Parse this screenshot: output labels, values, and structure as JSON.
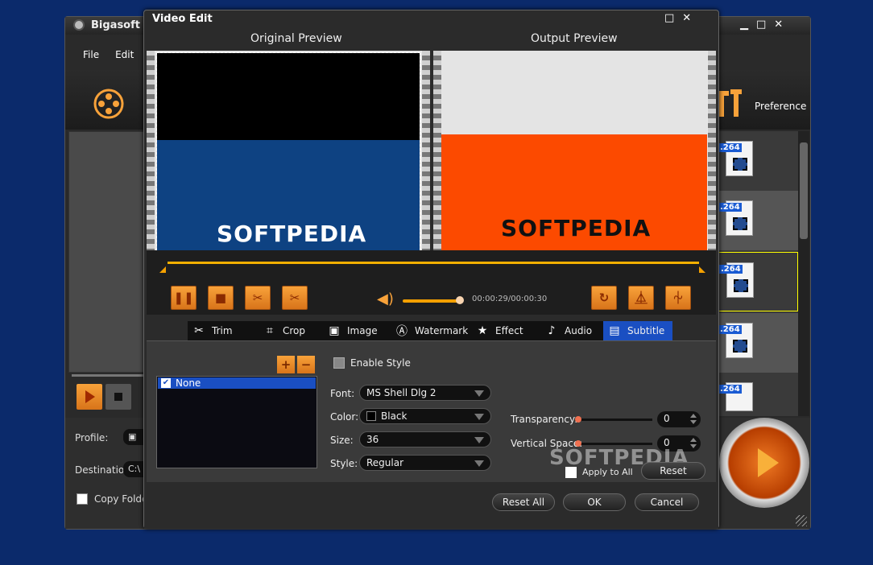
{
  "app": {
    "title": "Bigasoft To",
    "menu": [
      "File",
      "Edit"
    ],
    "preference_label": "Preference",
    "profile_label": "Profile:",
    "destination_label": "Destination:",
    "destination_value": "C:\\",
    "copy_folder_label": "Copy Folder",
    "file_tag": ".264"
  },
  "dialog": {
    "title": "Video Edit",
    "original_preview_label": "Original Preview",
    "output_preview_label": "Output Preview",
    "logo_text": "SOFTPEDIA",
    "time_display": "00:00:29/00:00:30",
    "tabs": [
      {
        "label": "Trim",
        "icon": "scissors-icon"
      },
      {
        "label": "Crop",
        "icon": "crop-icon"
      },
      {
        "label": "Image",
        "icon": "image-icon"
      },
      {
        "label": "Watermark",
        "icon": "watermark-icon"
      },
      {
        "label": "Effect",
        "icon": "star-icon"
      },
      {
        "label": "Audio",
        "icon": "music-note-icon"
      },
      {
        "label": "Subtitle",
        "icon": "subtitle-icon"
      }
    ],
    "active_tab": "Subtitle",
    "subtitle": {
      "list_items": [
        "None"
      ],
      "enable_style_label": "Enable Style",
      "font_label": "Font:",
      "font_value": "MS Shell Dlg 2",
      "color_label": "Color:",
      "color_value": "Black",
      "size_label": "Size:",
      "size_value": "36",
      "style_label": "Style:",
      "style_value": "Regular",
      "transparency_label": "Transparency:",
      "transparency_value": "0",
      "vertical_space_label": "Vertical Space:",
      "vertical_space_value": "0",
      "apply_all_label": "Apply to All",
      "reset_label": "Reset"
    },
    "footer": {
      "reset_all_label": "Reset All",
      "ok_label": "OK",
      "cancel_label": "Cancel"
    }
  },
  "colors": {
    "accent_orange": "#f8a23a",
    "selection_blue": "#1a4fc2",
    "desktop_blue": "#0b2a6b"
  }
}
